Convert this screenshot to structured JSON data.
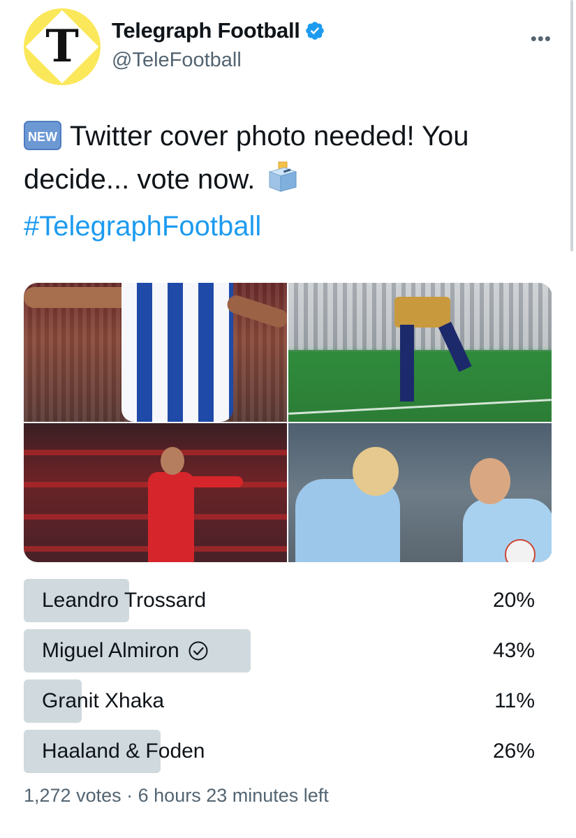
{
  "author": {
    "display_name": "Telegraph Football",
    "handle": "@TeleFootball",
    "avatar_letter": "T",
    "verified_icon": "verified-badge-icon",
    "brand_color": "#fae85a"
  },
  "tweet": {
    "badge": "NEW",
    "text": "Twitter cover photo needed! You decide... vote now.",
    "hashtag": "#TelegraphFootball",
    "more_icon": "more-options-icon"
  },
  "poll": {
    "options": [
      {
        "label": "Leandro Trossard",
        "percent": "20%",
        "value": 20,
        "selected": false
      },
      {
        "label": "Miguel Almiron",
        "percent": "43%",
        "value": 43,
        "selected": true
      },
      {
        "label": "Granit Xhaka",
        "percent": "11%",
        "value": 11,
        "selected": false
      },
      {
        "label": "Haaland & Foden",
        "percent": "26%",
        "value": 26,
        "selected": false
      }
    ],
    "votes": "1,272 votes",
    "separator": "·",
    "time_left": "6 hours 23 minutes left",
    "bar_color": "#cfd9de"
  },
  "colors": {
    "link": "#1d9bf0",
    "secondary_text": "#536471",
    "verified": "#1d9bf0"
  }
}
